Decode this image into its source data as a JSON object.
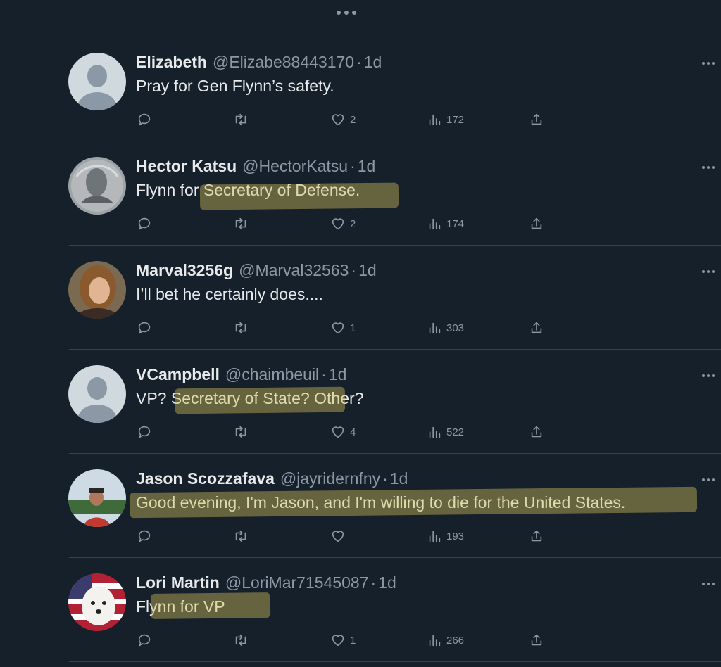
{
  "tweets": [
    {
      "name": "Elizabeth",
      "handle": "@Elizabe88443170",
      "dot": "·",
      "time": "1d",
      "text": "Pray for Gen Flynn’s safety.",
      "likes": "2",
      "views": "172",
      "avatar": "default"
    },
    {
      "name": "Hector Katsu",
      "handle": "@HectorKatsu",
      "dot": "·",
      "time": "1d",
      "text": "Flynn for Secretary of Defense.",
      "likes": "2",
      "views": "174",
      "avatar": "coin"
    },
    {
      "name": "Marval3256g",
      "handle": "@Marval32563",
      "dot": "·",
      "time": "1d",
      "text": "I’ll bet he certainly does....",
      "likes": "1",
      "views": "303",
      "avatar": "woman"
    },
    {
      "name": "VCampbell",
      "handle": "@chaimbeuil",
      "dot": "·",
      "time": "1d",
      "text": "VP? Secretary of State? Other?",
      "likes": "4",
      "views": "522",
      "avatar": "default"
    },
    {
      "name": "Jason Scozzafava",
      "handle": "@jayridernfny",
      "dot": "·",
      "time": "1d",
      "text": "Good evening, I'm Jason, and I'm willing to die for the United States.",
      "likes": "",
      "views": "193",
      "avatar": "man"
    },
    {
      "name": "Lori Martin",
      "handle": "@LoriMar71545087",
      "dot": "·",
      "time": "1d",
      "text": "Flynn for VP",
      "likes": "1",
      "views": "266",
      "avatar": "dog"
    }
  ],
  "icons": {
    "more_top": "more-horizontal-icon",
    "reply": "reply-icon",
    "retweet": "retweet-icon",
    "like": "heart-icon",
    "views": "views-chart-icon",
    "share": "share-icon"
  },
  "colors": {
    "background": "#15202b",
    "text": "#e7e9ea",
    "secondary": "#8b98a5",
    "divider": "#38444d",
    "highlight": "#d6c45a"
  }
}
